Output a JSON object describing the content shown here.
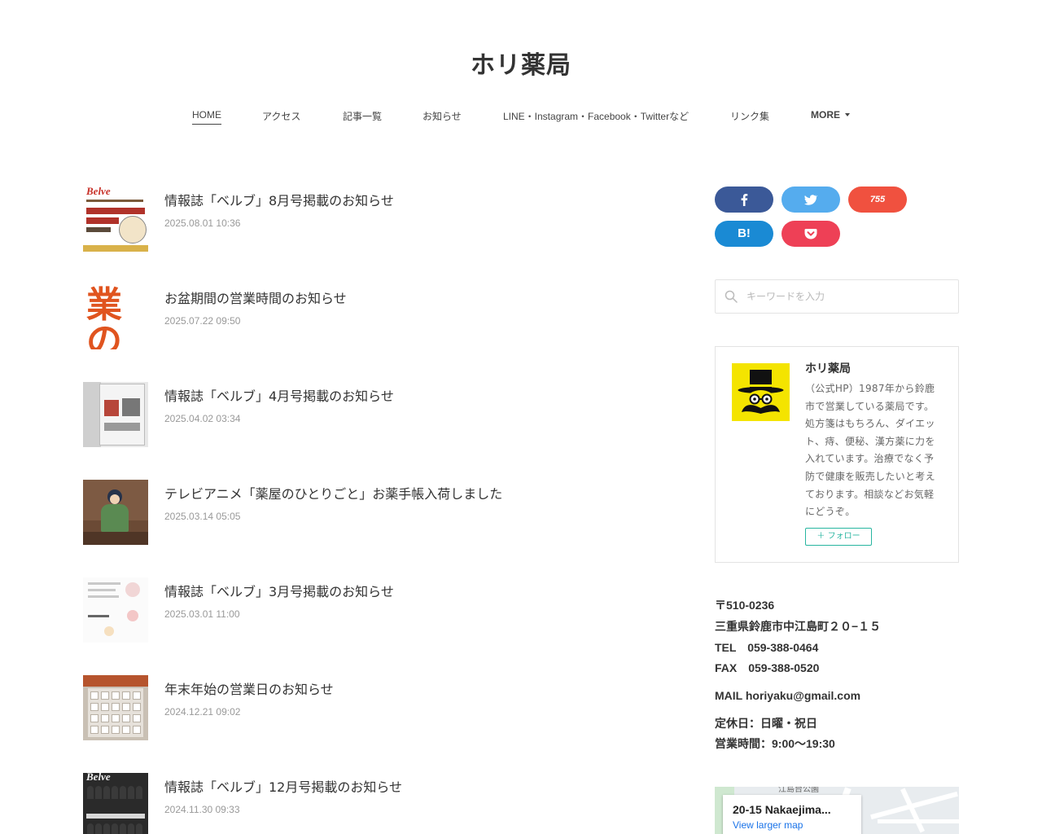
{
  "site": {
    "title": "ホリ薬局"
  },
  "nav": {
    "items": [
      {
        "label": "HOME"
      },
      {
        "label": "アクセス"
      },
      {
        "label": "記事一覧"
      },
      {
        "label": "お知らせ"
      },
      {
        "label": "LINE・Instagram・Facebook・Twitterなど"
      },
      {
        "label": "リンク集"
      },
      {
        "label": "MORE"
      }
    ]
  },
  "posts": [
    {
      "title": "情報誌「ベルブ」8月号掲載のお知らせ",
      "date": "2025.08.01 10:36",
      "thumb_text": "Belve"
    },
    {
      "title": "お盆期間の営業時間のお知らせ",
      "date": "2025.07.22 09:50",
      "thumb_text": "業の"
    },
    {
      "title": "情報誌「ベルブ」4月号掲載のお知らせ",
      "date": "2025.04.02 03:34"
    },
    {
      "title": "テレビアニメ「薬屋のひとりごと」お薬手帳入荷しました",
      "date": "2025.03.14 05:05"
    },
    {
      "title": "情報誌「ベルブ」3月号掲載のお知らせ",
      "date": "2025.03.01 11:00"
    },
    {
      "title": "年末年始の営業日のお知らせ",
      "date": "2024.12.21 09:02"
    },
    {
      "title": "情報誌「ベルブ」12月号掲載のお知らせ",
      "date": "2024.11.30 09:33",
      "thumb_text": "Belve"
    }
  ],
  "share": {
    "buttons": [
      {
        "icon": "facebook-icon",
        "label": "f",
        "color": "#3b5998"
      },
      {
        "icon": "twitter-icon",
        "label": "",
        "color": "#55acee"
      },
      {
        "icon": "line-icon",
        "label": "755",
        "color": "#f0513f"
      },
      {
        "icon": "hatena-bookmark-icon",
        "label": "B!",
        "color": "#1a8ad4"
      },
      {
        "icon": "pocket-icon",
        "label": "",
        "color": "#ee4056"
      }
    ]
  },
  "search": {
    "placeholder": "キーワードを入力"
  },
  "profile": {
    "name": "ホリ薬局",
    "description": "（公式HP）1987年から鈴鹿市で営業している薬局です。処方箋はもちろん、ダイエット、痔、便秘、漢方薬に力を入れています。治療でなく予防で健康を販売したいと考えております。相談などお気軽にどうぞ。",
    "follow_label": "フォロー",
    "accent": "#28b5a0"
  },
  "info": {
    "postal": "〒510-0236",
    "address": "三重県鈴鹿市中江島町２０−１５",
    "tel": "TEL　059-388-0464",
    "fax": "FAX　059-388-0520",
    "mail": "MAIL  horiyaku@gmail.com",
    "closed": "定休日：日曜・祝日",
    "hours": "営業時間：9:00〜19:30"
  },
  "map": {
    "title": "20-15 Nakaejima...",
    "link": "View larger map",
    "street_label": "江島台公園"
  }
}
